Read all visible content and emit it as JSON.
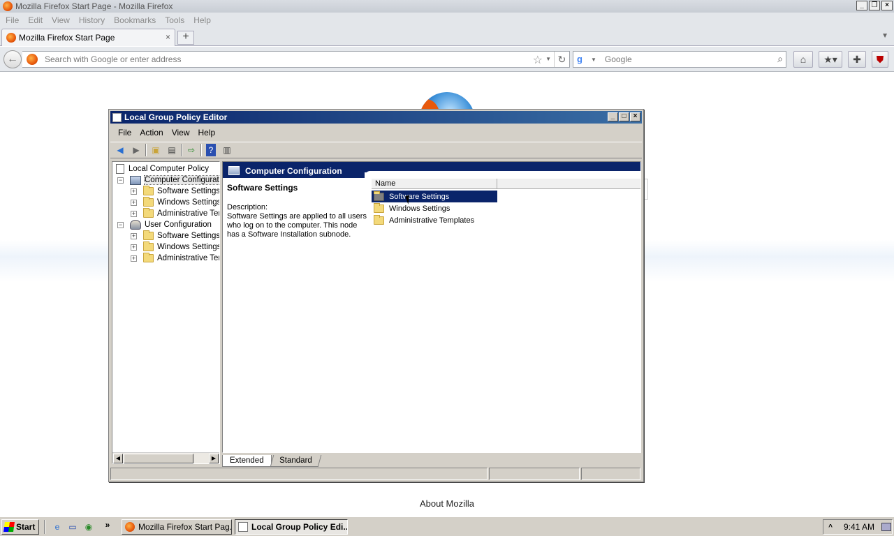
{
  "browser": {
    "window_title": "Mozilla Firefox Start Page - Mozilla Firefox",
    "menu": [
      "File",
      "Edit",
      "View",
      "History",
      "Bookmarks",
      "Tools",
      "Help"
    ],
    "tab_label": "Mozilla Firefox Start Page",
    "tab_close": "×",
    "new_tab": "+",
    "url_placeholder": "Search with Google or enter address",
    "search_engine": "Google",
    "content_link": "About Mozilla"
  },
  "mmc": {
    "title": "Local Group Policy Editor",
    "menu": [
      "File",
      "Action",
      "View",
      "Help"
    ],
    "tree": {
      "root": "Local Computer Policy",
      "computer": "Computer Configuratio",
      "computer_children": [
        "Software Settings",
        "Windows Settings",
        "Administrative Tem"
      ],
      "user": "User Configuration",
      "user_children": [
        "Software Settings",
        "Windows Settings",
        "Administrative Tem"
      ]
    },
    "header": "Computer Configuration",
    "description": {
      "title": "Software Settings",
      "label": "Description:",
      "text": "Software Settings are applied to all users who log on to the computer. This node has a Software Installation subnode."
    },
    "list": {
      "column": "Name",
      "items": [
        "Software Settings",
        "Windows Settings",
        "Administrative Templates"
      ],
      "selected_index": 0
    },
    "view_tabs": [
      "Extended",
      "Standard"
    ],
    "active_view_tab": "Extended"
  },
  "taskbar": {
    "start": "Start",
    "buttons": [
      "Mozilla Firefox Start Pag...",
      "Local Group Policy Edi..."
    ],
    "active_button_index": 1,
    "clock": "9:41 AM"
  },
  "colors": {
    "mmc_titlebar": "#0a246a",
    "selection": "#0a246a",
    "face": "#d4d0c8"
  }
}
